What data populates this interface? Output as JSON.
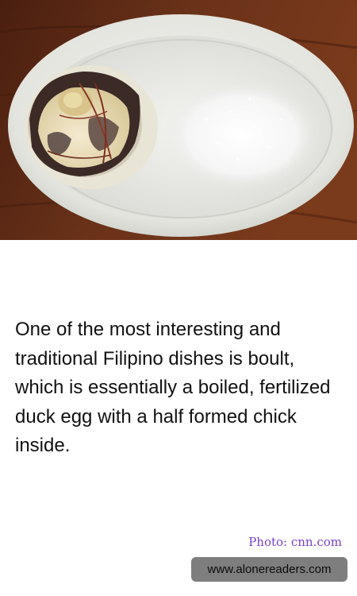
{
  "photo": {
    "subject": "balut egg in white oval dish with salt",
    "colors": {
      "table": "#5b2a17",
      "dish": "#e9eae5",
      "salt": "#ffffff",
      "egg_shell": "#e6e2d4",
      "yolk": "#f0e4be",
      "embryo": "#4a3a3a"
    }
  },
  "caption": {
    "text": "One of the most interesting and traditional Filipino dishes is boult, which is essentially a boiled, fertilized duck egg with a half formed chick inside."
  },
  "credit": {
    "text": "Photo: cnn.com",
    "color": "#7b3fd1"
  },
  "watermark": {
    "text": "www.alonereaders.com"
  }
}
